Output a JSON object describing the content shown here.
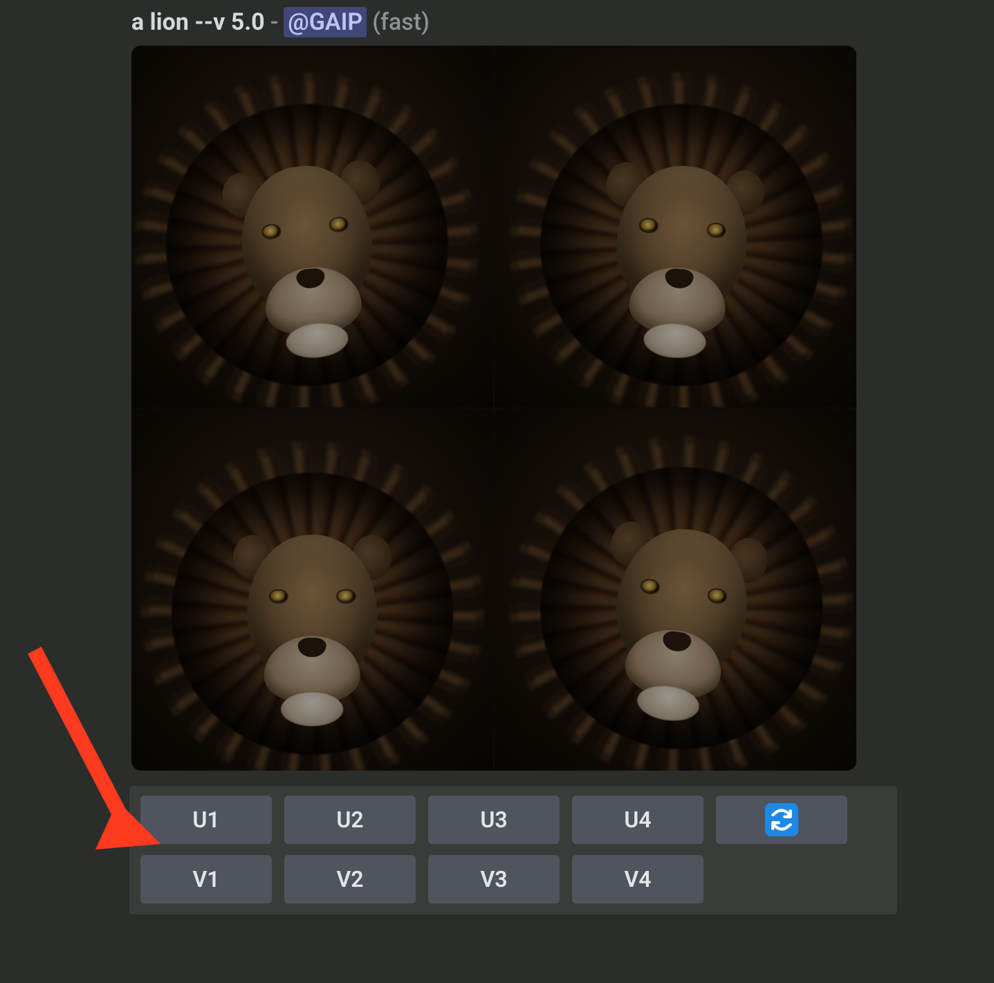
{
  "prompt": {
    "text": "a lion --v 5.0",
    "separator": "-",
    "mention": "@GAIP",
    "mode": "(fast)"
  },
  "image_grid": {
    "description": "2x2 grid of generated lion portrait images",
    "tiles": [
      "lion-1",
      "lion-2",
      "lion-3",
      "lion-4"
    ]
  },
  "buttons": {
    "row1": [
      "U1",
      "U2",
      "U3",
      "U4"
    ],
    "refresh_icon": "refresh-icon",
    "row2": [
      "V1",
      "V2",
      "V3",
      "V4"
    ]
  },
  "annotation": {
    "type": "arrow",
    "color": "#ff3b1f",
    "points_to": "U1 button"
  }
}
